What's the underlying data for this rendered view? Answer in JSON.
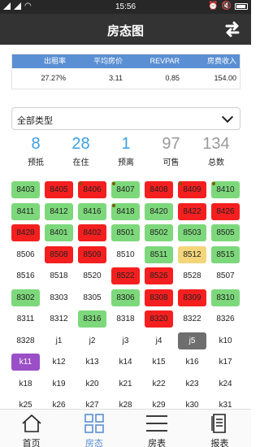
{
  "status_bar": {
    "time": "15:56"
  },
  "header": {
    "title": "房态图",
    "action_icon": "swap-arrows-icon"
  },
  "stats": {
    "headers": [
      "出租率",
      "平均房价",
      "REVPAR",
      "房费收入"
    ],
    "values": [
      "27.27%",
      "3.11",
      "0.85",
      "154.00"
    ]
  },
  "filter": {
    "selected": "全部类型"
  },
  "counts": [
    {
      "value": "8",
      "label": "预抵",
      "color": "#3aa0e0"
    },
    {
      "value": "28",
      "label": "在住",
      "color": "#3aa0e0"
    },
    {
      "value": "1",
      "label": "预离",
      "color": "#3aa0e0"
    },
    {
      "value": "97",
      "label": "可售",
      "color": "#9a9a9a"
    },
    {
      "value": "134",
      "label": "总数",
      "color": "#9a9a9a"
    }
  ],
  "room_colors": {
    "green": "#7dd87b",
    "red": "#f51f1f",
    "white": "#ffffff",
    "yellow": "#f3d57a",
    "gray": "#6e6e6e",
    "purple": "#9a4fc7"
  },
  "rooms": [
    [
      [
        "8403",
        "green"
      ],
      [
        "8405",
        "red"
      ],
      [
        "8406",
        "red"
      ],
      [
        "8407",
        "green"
      ],
      [
        "8408",
        "red"
      ],
      [
        "8409",
        "red"
      ],
      [
        "8410",
        "green"
      ]
    ],
    [
      [
        "8411",
        "green"
      ],
      [
        "8412",
        "green"
      ],
      [
        "8416",
        "green"
      ],
      [
        "8418",
        "green"
      ],
      [
        "8420",
        "green"
      ],
      [
        "8422",
        "red"
      ],
      [
        "8426",
        "red"
      ]
    ],
    [
      [
        "8428",
        "red"
      ],
      [
        "8401",
        "green"
      ],
      [
        "8402",
        "red"
      ],
      [
        "8501",
        "green"
      ],
      [
        "8502",
        "green"
      ],
      [
        "8503",
        "green"
      ],
      [
        "8505",
        "green"
      ]
    ],
    [
      [
        "8506",
        "white"
      ],
      [
        "8508",
        "red"
      ],
      [
        "8509",
        "red"
      ],
      [
        "8510",
        "white"
      ],
      [
        "8511",
        "green"
      ],
      [
        "8512",
        "yellow"
      ],
      [
        "8515",
        "green"
      ]
    ],
    [
      [
        "8516",
        "white"
      ],
      [
        "8518",
        "white"
      ],
      [
        "8520",
        "white"
      ],
      [
        "8522",
        "red"
      ],
      [
        "8526",
        "red"
      ],
      [
        "8528",
        "white"
      ],
      [
        "8507",
        "white"
      ]
    ],
    [
      [
        "8302",
        "green"
      ],
      [
        "8303",
        "white"
      ],
      [
        "8305",
        "white"
      ],
      [
        "8306",
        "green"
      ],
      [
        "8308",
        "red"
      ],
      [
        "8309",
        "red"
      ],
      [
        "8310",
        "green"
      ]
    ],
    [
      [
        "8311",
        "white"
      ],
      [
        "8312",
        "white"
      ],
      [
        "8316",
        "green"
      ],
      [
        "8318",
        "white"
      ],
      [
        "8320",
        "red"
      ],
      [
        "8322",
        "white"
      ],
      [
        "8326",
        "white"
      ]
    ],
    [
      [
        "8328",
        "white"
      ],
      [
        "j1",
        "white"
      ],
      [
        "j2",
        "white"
      ],
      [
        "j3",
        "white"
      ],
      [
        "j4",
        "white"
      ],
      [
        "j5",
        "gray"
      ],
      [
        "k10",
        "white"
      ]
    ],
    [
      [
        "k11",
        "purple"
      ],
      [
        "k12",
        "white"
      ],
      [
        "k13",
        "white"
      ],
      [
        "k14",
        "white"
      ],
      [
        "k15",
        "white"
      ],
      [
        "k16",
        "white"
      ],
      [
        "k17",
        "white"
      ]
    ],
    [
      [
        "k18",
        "white"
      ],
      [
        "k19",
        "white"
      ],
      [
        "k20",
        "white"
      ],
      [
        "k21",
        "white"
      ],
      [
        "k22",
        "white"
      ],
      [
        "k23",
        "white"
      ],
      [
        "k24",
        "white"
      ]
    ],
    [
      [
        "k25",
        "white"
      ],
      [
        "k26",
        "white"
      ],
      [
        "k27",
        "white"
      ],
      [
        "k28",
        "white"
      ],
      [
        "k29",
        "white"
      ],
      [
        "k30",
        "white"
      ],
      [
        "k31",
        "white"
      ]
    ]
  ],
  "dotted_rooms": [
    "8406",
    "8407",
    "8409",
    "8410",
    "8418"
  ],
  "tabs": [
    {
      "label": "首页",
      "icon": "home-icon"
    },
    {
      "label": "房态",
      "icon": "grid-icon",
      "active": true
    },
    {
      "label": "房表",
      "icon": "menu-lines-icon"
    },
    {
      "label": "报表",
      "icon": "report-icon"
    }
  ]
}
